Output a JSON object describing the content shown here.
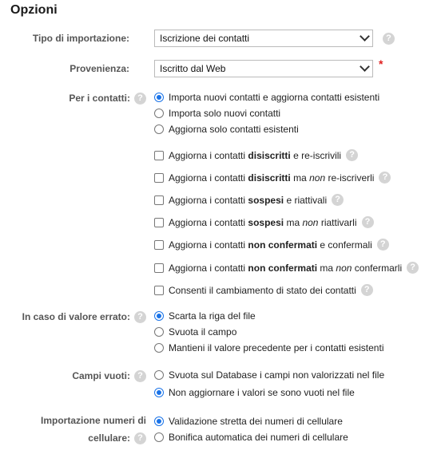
{
  "title": "Opzioni",
  "tipo": {
    "label": "Tipo di importazione:",
    "value": "Iscrizione dei contatti"
  },
  "provenienza": {
    "label": "Provenienza:",
    "value": "Iscritto dal Web",
    "required_mark": "*"
  },
  "per_contatti": {
    "label": "Per i contatti:",
    "radios": [
      {
        "text": "Importa nuovi contatti e aggiorna contatti esistenti",
        "checked": true
      },
      {
        "text": "Importa solo nuovi contatti",
        "checked": false
      },
      {
        "text": "Aggiorna solo contatti esistenti",
        "checked": false
      }
    ],
    "checkboxes": [
      {
        "pre": "Aggiorna i contatti ",
        "bold": "disiscritti",
        "mid": " e re-iscrivili",
        "ital": "",
        "post": ""
      },
      {
        "pre": "Aggiorna i contatti ",
        "bold": "disiscritti",
        "mid": " ma ",
        "ital": "non",
        "post": " re-iscriverli"
      },
      {
        "pre": "Aggiorna i contatti ",
        "bold": "sospesi",
        "mid": " e riattivali",
        "ital": "",
        "post": ""
      },
      {
        "pre": "Aggiorna i contatti ",
        "bold": "sospesi",
        "mid": " ma ",
        "ital": "non",
        "post": " riattivarli"
      },
      {
        "pre": "Aggiorna i contatti ",
        "bold": "non confermati",
        "mid": " e confermali",
        "ital": "",
        "post": ""
      },
      {
        "pre": "Aggiorna i contatti ",
        "bold": "non confermati",
        "mid": " ma ",
        "ital": "non",
        "post": " confermarli"
      },
      {
        "pre": "Consenti il cambiamento di stato dei contatti",
        "bold": "",
        "mid": "",
        "ital": "",
        "post": ""
      }
    ]
  },
  "valore_errato": {
    "label": "In caso di valore errato:",
    "radios": [
      {
        "text": "Scarta la riga del file",
        "checked": true
      },
      {
        "text": "Svuota il campo",
        "checked": false
      },
      {
        "text": "Mantieni il valore precedente per i contatti esistenti",
        "checked": false
      }
    ]
  },
  "campi_vuoti": {
    "label": "Campi vuoti:",
    "radios": [
      {
        "text": "Svuota sul Database i campi non valorizzati nel file",
        "checked": false
      },
      {
        "text": "Non aggiornare i valori se sono vuoti nel file",
        "checked": true
      }
    ]
  },
  "cellulare": {
    "label_line1": "Importazione numeri di",
    "label_line2": "cellulare:",
    "radios": [
      {
        "text": "Validazione stretta dei numeri di cellulare",
        "checked": true
      },
      {
        "text": "Bonifica automatica dei numeri di cellulare",
        "checked": false
      }
    ]
  },
  "help_glyph": "?",
  "colors": {
    "accent": "#1a73e8",
    "required": "#e02020",
    "label": "#555555",
    "help_bg": "#d4d4d4"
  }
}
